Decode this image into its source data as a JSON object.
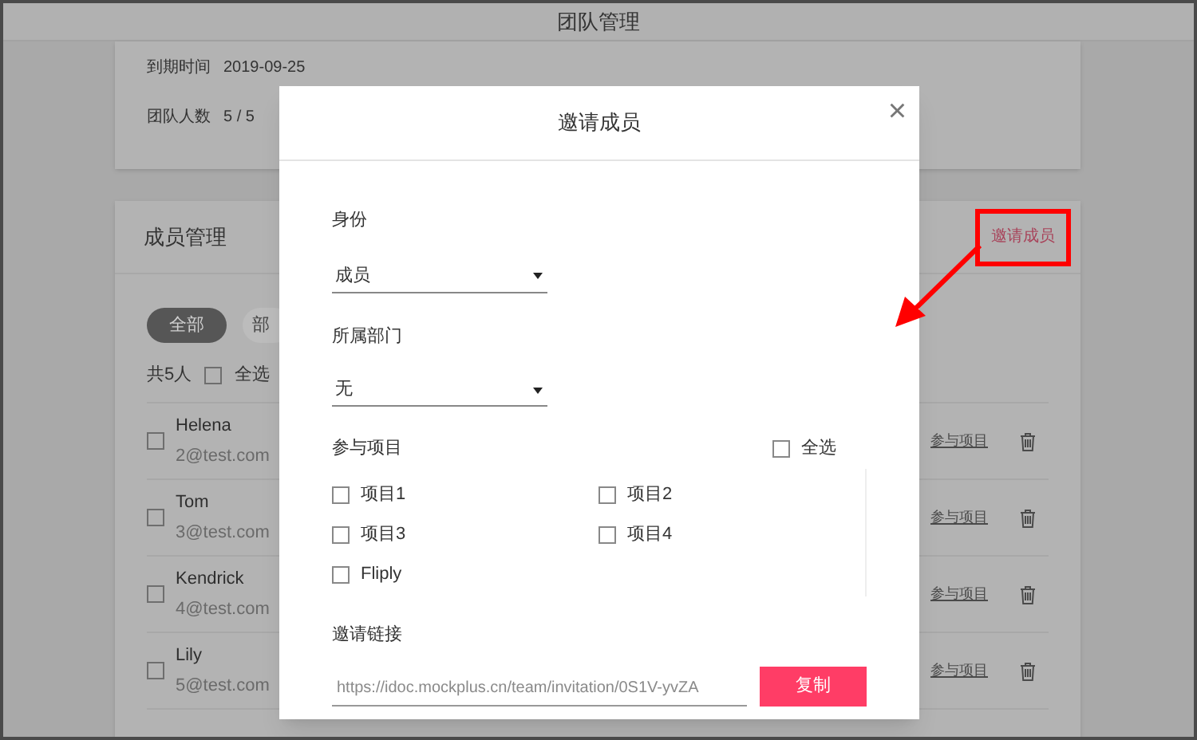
{
  "window": {
    "title": "团队管理"
  },
  "team_info": [
    {
      "label": "到期时间",
      "value": "2019-09-25"
    },
    {
      "label": "团队人数",
      "value": "5 / 5"
    }
  ],
  "members_panel": {
    "title": "成员管理",
    "invite_link": "邀请成员",
    "filters": [
      {
        "label": "全部",
        "selected": true
      },
      {
        "label": "部",
        "selected": false
      }
    ],
    "count": "共5人",
    "select_all": {
      "label": "全选",
      "checked": false
    },
    "members": [
      {
        "name": "Helena",
        "email": "2@test.com",
        "checked": false,
        "action": "参与项目"
      },
      {
        "name": "Tom",
        "email": "3@test.com",
        "checked": false,
        "action": "参与项目"
      },
      {
        "name": "Kendrick",
        "email": "4@test.com",
        "checked": false,
        "action": "参与项目"
      },
      {
        "name": "Lily",
        "email": "5@test.com",
        "checked": false,
        "action": "参与项目"
      }
    ]
  },
  "dialog": {
    "title": "邀请成员",
    "close": "×",
    "role": {
      "label": "身份",
      "value": "成员"
    },
    "department": {
      "label": "所属部门",
      "value": "无"
    },
    "projects": {
      "label": "参与项目",
      "select_all": {
        "label": "全选",
        "checked": false
      },
      "items": [
        {
          "label": "项目1",
          "checked": false
        },
        {
          "label": "项目2",
          "checked": false
        },
        {
          "label": "项目3",
          "checked": false
        },
        {
          "label": "项目4",
          "checked": false
        },
        {
          "label": "Fliply",
          "checked": false
        }
      ]
    },
    "invite_link": {
      "label": "邀请链接",
      "value": "https://idoc.mockplus.cn/team/invitation/0S1V-yvZA",
      "button": "复制"
    }
  }
}
